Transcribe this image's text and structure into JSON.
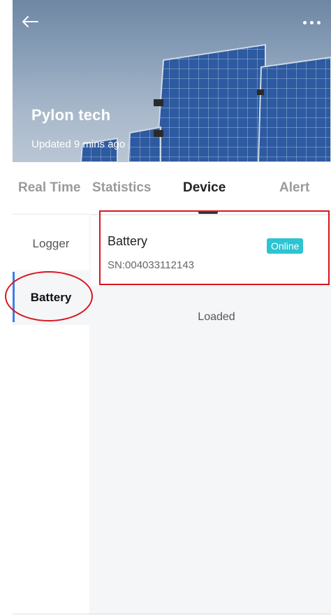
{
  "header": {
    "station_name": "Pylon tech",
    "updated_text": "Updated 9 mins ago",
    "back_icon": "arrow-left-icon",
    "more_icon": "more-dots-icon"
  },
  "tabs": [
    {
      "label": "Real Time",
      "active": false
    },
    {
      "label": "Statistics",
      "active": false
    },
    {
      "label": "Device",
      "active": true
    },
    {
      "label": "Alert",
      "active": false
    }
  ],
  "sidebar": {
    "items": [
      {
        "label": "Logger",
        "active": false
      },
      {
        "label": "Battery",
        "active": true
      }
    ]
  },
  "device": {
    "name": "Battery",
    "sn": "SN:004033112143",
    "status": "Online"
  },
  "list_footer": "Loaded",
  "colors": {
    "accent": "#3c7fe6",
    "online_badge": "#2bc4d2",
    "annotation": "#d9161e"
  }
}
